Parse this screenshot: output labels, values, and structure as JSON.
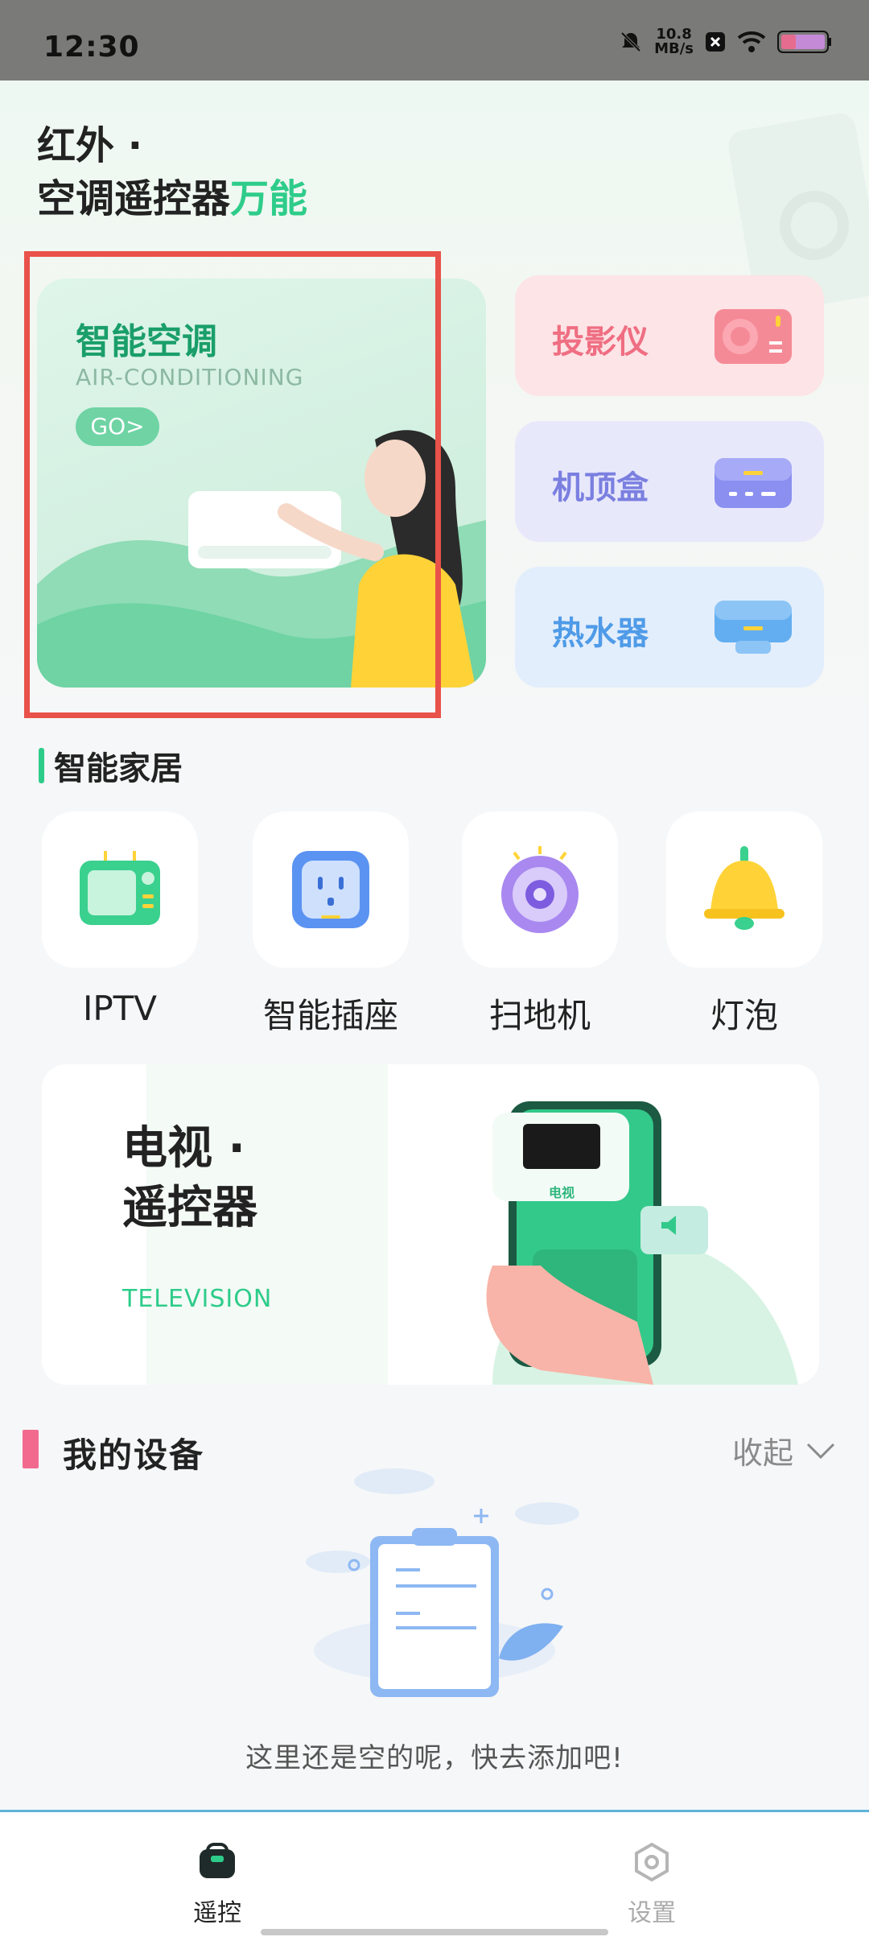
{
  "status_bar": {
    "time": "12:30",
    "net_speed_value": "10.8",
    "net_speed_unit": "MB/s"
  },
  "header": {
    "title_line1": "红外 ·",
    "title_line2_main": "空调遥控器",
    "title_line2_accent": "万能",
    "accent_color": "#2ecc8a"
  },
  "featured": {
    "title": "智能空调",
    "subtitle": "AIR-CONDITIONING",
    "go_label": "GO>"
  },
  "side_cards": [
    {
      "label": "投影仪",
      "icon": "projector-icon",
      "color": "#ef6e82"
    },
    {
      "label": "机顶盒",
      "icon": "set-top-box-icon",
      "color": "#7a7fe0"
    },
    {
      "label": "热水器",
      "icon": "water-heater-icon",
      "color": "#4f9be8"
    }
  ],
  "smart_home": {
    "title": "智能家居",
    "items": [
      {
        "label": "IPTV",
        "icon": "iptv-icon"
      },
      {
        "label": "智能插座",
        "icon": "smart-socket-icon"
      },
      {
        "label": "扫地机",
        "icon": "robot-vacuum-icon"
      },
      {
        "label": "灯泡",
        "icon": "light-bulb-icon"
      }
    ]
  },
  "tv_banner": {
    "title_line1": "电视 ·",
    "title_line2": "遥控器",
    "subtitle": "TELEVISION",
    "screen_label": "电视"
  },
  "my_devices": {
    "title": "我的设备",
    "collapse_label": "收起",
    "empty_text": "这里还是空的呢，快去添加吧!"
  },
  "bottom_nav": {
    "remote_label": "遥控",
    "settings_label": "设置"
  }
}
